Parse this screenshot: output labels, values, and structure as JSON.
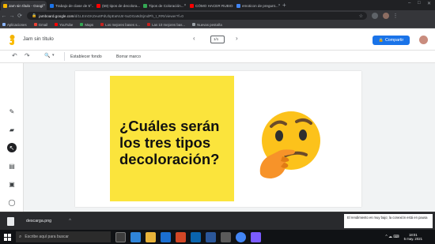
{
  "browser": {
    "tabs": [
      {
        "label": "Jam sin título - Googl",
        "color": "#f4b400",
        "active": true
      },
      {
        "label": "Trabajo de clase de 5°...",
        "color": "#1a73e8",
        "active": false
      },
      {
        "label": "(59) tipos de decolora...",
        "color": "#ff0000",
        "active": false
      },
      {
        "label": "Tipos de Coloración...",
        "color": "#34a853",
        "active": false
      },
      {
        "label": "CÓMO HACER RUBIO...",
        "color": "#ff0000",
        "active": false
      },
      {
        "label": "emoticon de pregunt...",
        "color": "#4285f4",
        "active": false
      }
    ],
    "new_tab": "+",
    "window_controls": [
      "–",
      "□",
      "✕"
    ],
    "url_host": "jamboard.google.com",
    "url_path": "/d/1LEmGKZeu8PdUbpEaNUtr-5uDGa9dSjmdPh_t_RRI/viewer?f=0",
    "bookmarks": [
      {
        "label": "Aplicaciones",
        "color": "#8ab4f8"
      },
      {
        "label": "Gmail",
        "color": "#ea4335"
      },
      {
        "label": "YouTube",
        "color": "#ff0000"
      },
      {
        "label": "Maps",
        "color": "#34a853"
      },
      {
        "label": "Los mejores bases s...",
        "color": "#c5221f"
      },
      {
        "label": "Las 10 mejores bas...",
        "color": "#c5221f"
      },
      {
        "label": "Nuevas pestaña",
        "color": "#9aa0a6"
      }
    ]
  },
  "jamboard": {
    "title": "Jam sin título",
    "frame_indicator": "1/1",
    "share_label": "Compartir",
    "toolbar": {
      "undo": "↶",
      "redo": "↷",
      "zoom": "🔍",
      "set_background": "Establecer fondo",
      "clear_frame": "Borrar marco"
    },
    "sticky_note": {
      "text": "¿Cuáles serán\nlos tres tipos\ndecoloración?",
      "color": "#fbe43c"
    }
  },
  "downloads": {
    "file": "descarga.png",
    "chevron": "^"
  },
  "taskbar": {
    "search_placeholder": "Escribe aquí para buscar",
    "notification": "El rendimiento es muy bajo; la conexión está en pausa",
    "time": "18:01",
    "date": "5 may. 2021"
  }
}
